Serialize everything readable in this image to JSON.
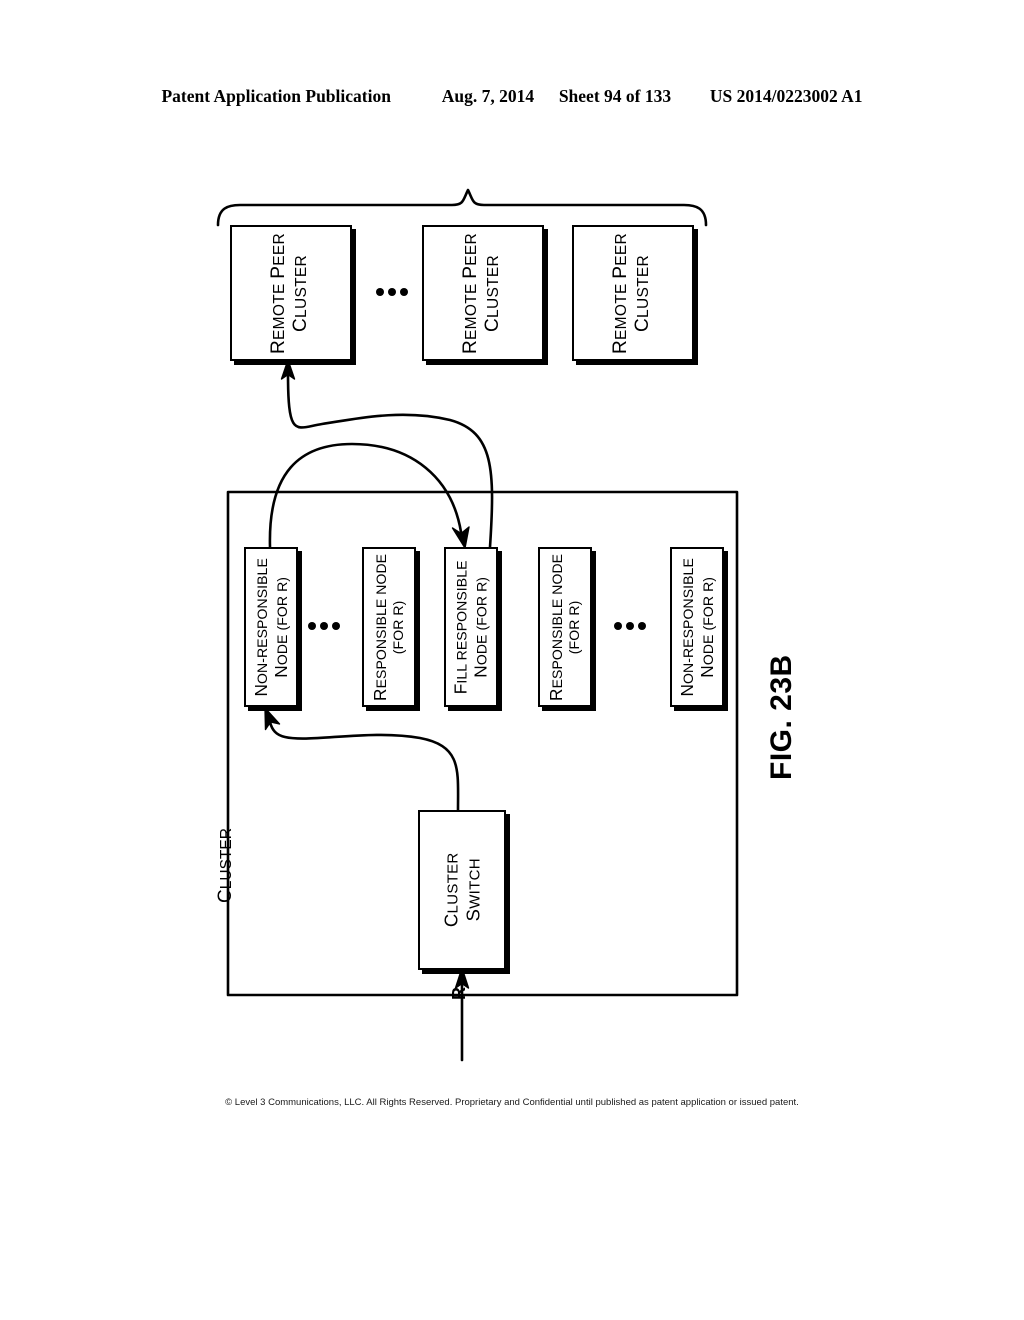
{
  "header": {
    "publication": "Patent Application Publication",
    "date": "Aug. 7, 2014",
    "sheet": "Sheet 94 of 133",
    "patent_number": "US 2014/0223002 A1"
  },
  "figure": {
    "label_prefix": "F",
    "label_rest": "IG. 23B",
    "label_full": "FIG. 23B",
    "cluster_label": "CLUSTER",
    "input_label": "R"
  },
  "peer_clusters": [
    {
      "line1_first": "R",
      "line1_rest": "EMOTE ",
      "line1_second": "P",
      "line1_tail": "EER",
      "line2_first": "C",
      "line2_rest": "LUSTER",
      "full": "REMOTE PEER CLUSTER"
    },
    {
      "line1_first": "R",
      "line1_rest": "EMOTE ",
      "line1_second": "P",
      "line1_tail": "EER",
      "line2_first": "C",
      "line2_rest": "LUSTER",
      "full": "REMOTE PEER CLUSTER"
    },
    {
      "line1_first": "R",
      "line1_rest": "EMOTE ",
      "line1_second": "P",
      "line1_tail": "EER",
      "line2_first": "C",
      "line2_rest": "LUSTER",
      "full": "REMOTE PEER CLUSTER"
    }
  ],
  "nodes": [
    {
      "line1_first": "N",
      "line1_rest": "ON-RESPONSIBLE",
      "line2_first": "N",
      "line2_rest": "ODE (FOR R)",
      "full": "NON-RESPONSIBLE NODE (FOR R)"
    },
    {
      "line1_first": "R",
      "line1_rest": "ESPONSIBLE NODE",
      "line2_first": "(",
      "line2_rest": "FOR R)",
      "full": "RESPONSIBLE NODE (FOR R)"
    },
    {
      "line1_first": "F",
      "line1_rest": "ILL RESPONSIBLE",
      "line2_first": "N",
      "line2_rest": "ODE (FOR R)",
      "full": "FILL RESPONSIBLE NODE (FOR R)"
    },
    {
      "line1_first": "R",
      "line1_rest": "ESPONSIBLE NODE",
      "line2_first": "(",
      "line2_rest": "FOR R)",
      "full": "RESPONSIBLE NODE (FOR R)"
    },
    {
      "line1_first": "N",
      "line1_rest": "ON-RESPONSIBLE",
      "line2_first": "N",
      "line2_rest": "ODE (FOR R)",
      "full": "NON-RESPONSIBLE NODE (FOR R)"
    }
  ],
  "cluster_switch": {
    "line1_first": "C",
    "line1_rest": "LUSTER",
    "line2_first": "S",
    "line2_rest": "WITCH",
    "full": "CLUSTER SWITCH"
  },
  "footer": {
    "notice": "© Level 3 Communications, LLC.  All Rights Reserved.  Proprietary and Confidential until published as patent application or issued patent."
  },
  "colors": {
    "ink": "#000000",
    "paper": "#ffffff"
  }
}
